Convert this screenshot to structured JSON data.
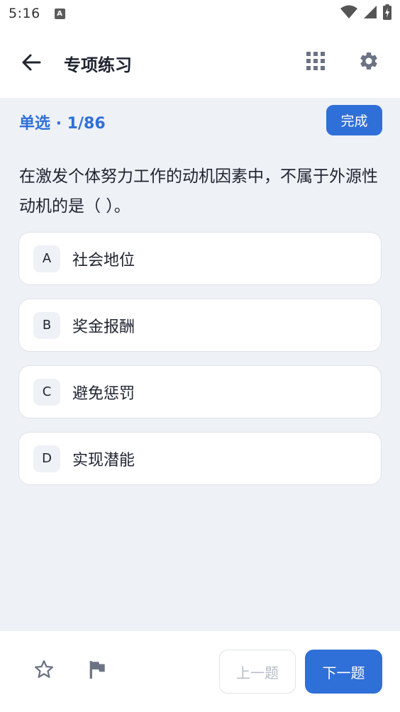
{
  "status_bar": {
    "time": "5:16",
    "notification_glyph": "A"
  },
  "header": {
    "title": "专项练习"
  },
  "question": {
    "meta": "单选 · 1/86",
    "done_label": "完成",
    "text": "在激发个体努力工作的动机因素中，不属于外源性动机的是（ ）。"
  },
  "options": [
    {
      "letter": "A",
      "text": "社会地位"
    },
    {
      "letter": "B",
      "text": "奖金报酬"
    },
    {
      "letter": "C",
      "text": "避免惩罚"
    },
    {
      "letter": "D",
      "text": "实现潜能"
    }
  ],
  "footer": {
    "prev_label": "上一题",
    "next_label": "下一题"
  },
  "colors": {
    "accent": "#2f6fd8",
    "background": "#eef1f6",
    "text": "#1f2430",
    "disabled_text": "#b6bcc8"
  },
  "icons": [
    "back-arrow-icon",
    "grid-icon",
    "gear-icon",
    "star-icon",
    "flag-icon",
    "wifi-icon",
    "signal-icon",
    "battery-icon"
  ]
}
